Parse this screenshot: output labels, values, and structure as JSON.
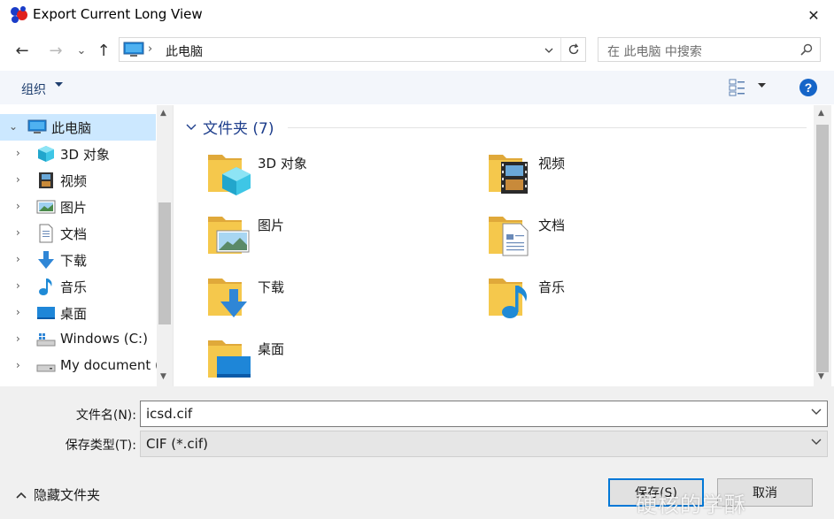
{
  "window": {
    "title": "Export Current Long View",
    "close_glyph": "✕"
  },
  "nav": {
    "back_glyph": "←",
    "forward_glyph": "→",
    "recent_glyph": "⌄",
    "up_glyph": "↑"
  },
  "address": {
    "chevron": "›",
    "location": "此电脑"
  },
  "search": {
    "placeholder": "在 此电脑 中搜索"
  },
  "toolbar": {
    "organize_label": "组织",
    "help_glyph": "?"
  },
  "sidebar": {
    "items": [
      {
        "label": "此电脑",
        "icon": "pc-icon",
        "selected": true
      },
      {
        "label": "3D 对象",
        "icon": "3d-objects-icon"
      },
      {
        "label": "视频",
        "icon": "video-icon"
      },
      {
        "label": "图片",
        "icon": "pictures-icon"
      },
      {
        "label": "文档",
        "icon": "documents-icon"
      },
      {
        "label": "下载",
        "icon": "download-icon"
      },
      {
        "label": "音乐",
        "icon": "music-icon"
      },
      {
        "label": "桌面",
        "icon": "desktop-icon"
      },
      {
        "label": "Windows (C:)",
        "icon": "drive-c-icon"
      },
      {
        "label": "My document (",
        "icon": "drive-icon"
      }
    ],
    "expander": "›",
    "expander_open": "⌄",
    "scroll_up": "▲",
    "scroll_down": "▼"
  },
  "main": {
    "group_label": "文件夹 (7)",
    "folders": [
      {
        "label": "3D 对象",
        "icon": "3d-objects-folder-icon"
      },
      {
        "label": "视频",
        "icon": "video-folder-icon"
      },
      {
        "label": "图片",
        "icon": "pictures-folder-icon"
      },
      {
        "label": "文档",
        "icon": "documents-folder-icon"
      },
      {
        "label": "下载",
        "icon": "download-folder-icon"
      },
      {
        "label": "音乐",
        "icon": "music-folder-icon"
      },
      {
        "label": "桌面",
        "icon": "desktop-folder-icon"
      }
    ]
  },
  "form": {
    "filename_label": "文件名(N):",
    "filename_value": "icsd.cif",
    "filetype_label": "保存类型(T):",
    "filetype_value": "CIF (*.cif)"
  },
  "footer": {
    "hide_folders_label": "隐藏文件夹",
    "save_label": "保存(S)",
    "cancel_label": "取消",
    "watermark_text": "硬核的学酥"
  },
  "colors": {
    "accent": "#0078d7",
    "selection": "#cce8ff",
    "folder": "#f5c84c",
    "link": "#1e3e8c"
  }
}
